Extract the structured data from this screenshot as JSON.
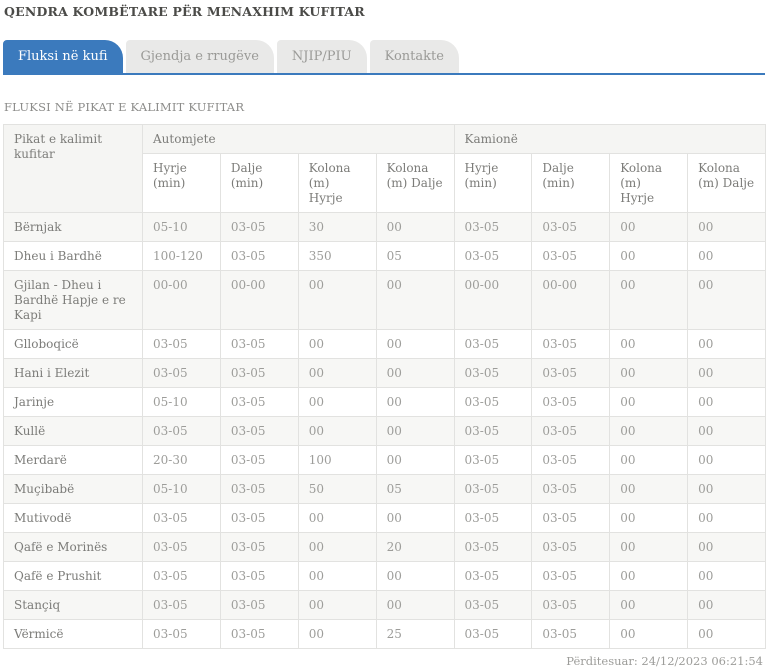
{
  "page": {
    "title": "QENDRA KOMBËTARE PËR MENAXHIM KUFITAR"
  },
  "tabs": [
    {
      "label": "Fluksi në kufi",
      "active": true
    },
    {
      "label": "Gjendja e rrugëve",
      "active": false
    },
    {
      "label": "NJIP/PIU",
      "active": false
    },
    {
      "label": "Kontakte",
      "active": false
    }
  ],
  "section": {
    "heading": "FLUKSI NË PIKAT E KALIMIT KUFITAR"
  },
  "table": {
    "first_column_header": "Pikat e kalimit kufitar",
    "groups": [
      {
        "label": "Automjete"
      },
      {
        "label": "Kamionë"
      }
    ],
    "subheaders": [
      "Hyrje (min)",
      "Dalje (min)",
      "Kolona (m) Hyrje",
      "Kolona (m) Dalje"
    ],
    "rows": [
      {
        "name": "Bërnjak",
        "values": [
          "05-10",
          "03-05",
          "30",
          "00",
          "03-05",
          "03-05",
          "00",
          "00"
        ]
      },
      {
        "name": "Dheu i Bardhë",
        "values": [
          "100-120",
          "03-05",
          "350",
          "05",
          "03-05",
          "03-05",
          "00",
          "00"
        ]
      },
      {
        "name": "Gjilan - Dheu i Bardhë Hapje e re Kapi",
        "values": [
          "00-00",
          "00-00",
          "00",
          "00",
          "00-00",
          "00-00",
          "00",
          "00"
        ]
      },
      {
        "name": "Glloboqicë",
        "values": [
          "03-05",
          "03-05",
          "00",
          "00",
          "03-05",
          "03-05",
          "00",
          "00"
        ]
      },
      {
        "name": "Hani i Elezit",
        "values": [
          "03-05",
          "03-05",
          "00",
          "00",
          "03-05",
          "03-05",
          "00",
          "00"
        ]
      },
      {
        "name": "Jarinje",
        "values": [
          "05-10",
          "03-05",
          "00",
          "00",
          "03-05",
          "03-05",
          "00",
          "00"
        ]
      },
      {
        "name": "Kullë",
        "values": [
          "03-05",
          "03-05",
          "00",
          "00",
          "03-05",
          "03-05",
          "00",
          "00"
        ]
      },
      {
        "name": "Merdarë",
        "values": [
          "20-30",
          "03-05",
          "100",
          "00",
          "03-05",
          "03-05",
          "00",
          "00"
        ]
      },
      {
        "name": "Muçibabë",
        "values": [
          "05-10",
          "03-05",
          "50",
          "05",
          "03-05",
          "03-05",
          "00",
          "00"
        ]
      },
      {
        "name": "Mutivodë",
        "values": [
          "03-05",
          "03-05",
          "00",
          "00",
          "03-05",
          "03-05",
          "00",
          "00"
        ]
      },
      {
        "name": "Qafë e Morinës",
        "values": [
          "03-05",
          "03-05",
          "00",
          "20",
          "03-05",
          "03-05",
          "00",
          "00"
        ]
      },
      {
        "name": "Qafë e Prushit",
        "values": [
          "03-05",
          "03-05",
          "00",
          "00",
          "03-05",
          "03-05",
          "00",
          "00"
        ]
      },
      {
        "name": "Stançiq",
        "values": [
          "03-05",
          "03-05",
          "00",
          "00",
          "03-05",
          "03-05",
          "00",
          "00"
        ]
      },
      {
        "name": "Vërmicë",
        "values": [
          "03-05",
          "03-05",
          "00",
          "25",
          "03-05",
          "03-05",
          "00",
          "00"
        ]
      }
    ]
  },
  "footer": {
    "updated": "Përditesuar: 24/12/2023 06:21:54"
  },
  "colors": {
    "accent_blue": "#3b7abd",
    "tab_inactive_bg": "#e9e9e8",
    "stripe_bg": "#f7f7f5",
    "header_bg": "#f5f5f3",
    "border": "#e2e2e0"
  }
}
